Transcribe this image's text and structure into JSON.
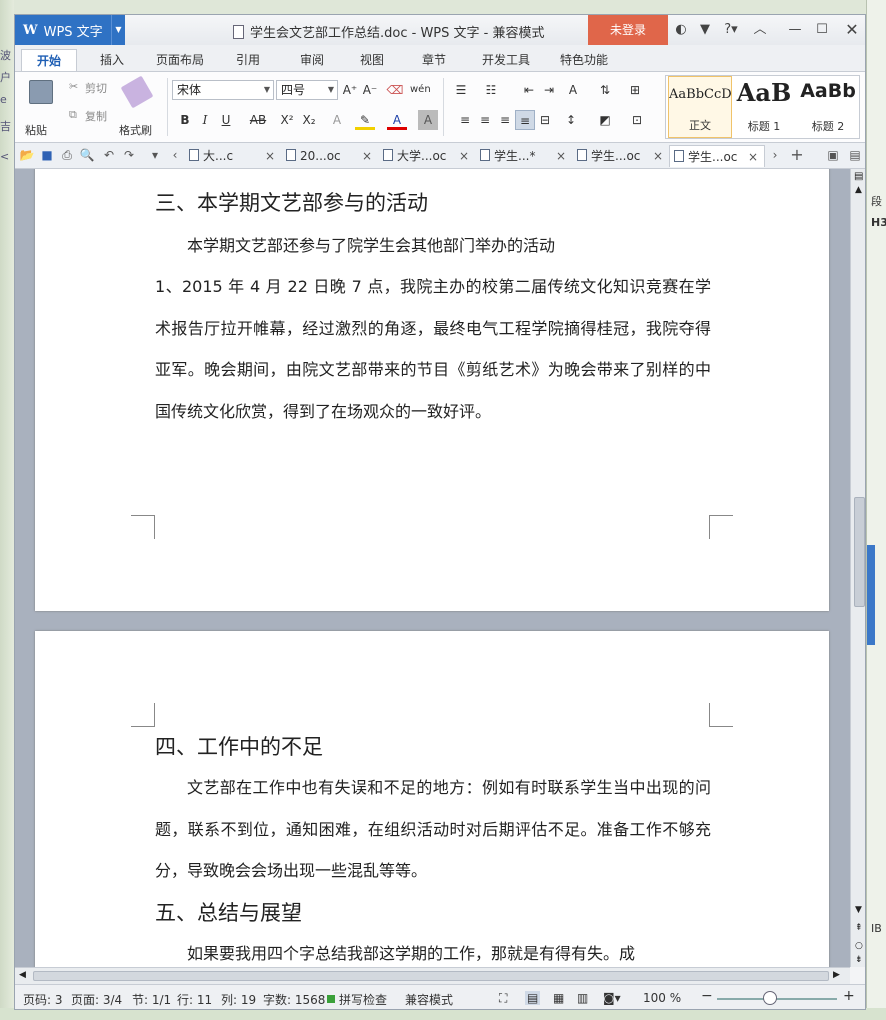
{
  "app": {
    "name": "WPS 文字",
    "login": "未登录"
  },
  "window": {
    "title": "学生会文艺部工作总结.doc - WPS 文字 - 兼容模式"
  },
  "menu_tabs": [
    "开始",
    "插入",
    "页面布局",
    "引用",
    "审阅",
    "视图",
    "章节",
    "开发工具",
    "特色功能"
  ],
  "ribbon": {
    "paste": "粘贴",
    "cut": "剪切",
    "copy": "复制",
    "format_painter": "格式刷",
    "font_name": "宋体",
    "font_size": "四号",
    "styles": [
      {
        "preview": "AaBbCcD",
        "label": "正文"
      },
      {
        "preview": "AaB",
        "label": "标题 1"
      },
      {
        "preview": "AaBb",
        "label": "标题 2"
      }
    ]
  },
  "doc_tabs": [
    {
      "label": "大...c",
      "close": "×"
    },
    {
      "label": "20...oc",
      "close": "×"
    },
    {
      "label": "大学...oc",
      "close": "×"
    },
    {
      "label": "学生...*",
      "close": "×"
    },
    {
      "label": "学生...oc",
      "close": "×"
    },
    {
      "label": "学生...oc",
      "close": "×"
    }
  ],
  "document": {
    "page1": {
      "heading": "三、本学期文艺部参与的活动",
      "para1": "本学期文艺部还参与了院学生会其他部门举办的活动",
      "para2": "1、2015 年 4 月 22 日晚 7 点，我院主办的校第二届传统文化知识竞赛在学术报告厅拉开帷幕，经过激烈的角逐，最终电气工程学院摘得桂冠，我院夺得亚军。晚会期间，由院文艺部带来的节目《剪纸艺术》为晚会带来了别样的中国传统文化欣赏，得到了在场观众的一致好评。"
    },
    "page2": {
      "heading1": "四、工作中的不足",
      "para1": "文艺部在工作中也有失误和不足的地方：例如有时联系学生当中出现的问题，联系不到位，通知困难，在组织活动时对后期评估不足。准备工作不够充分，导致晚会会场出现一些混乱等等。",
      "heading2": "五、总结与展望",
      "para2": "如果要我用四个字总结我部这学期的工作，那就是有得有失。成"
    }
  },
  "status": {
    "page_code": "页码: 3",
    "page": "页面: 3/4",
    "section": "节: 1/1",
    "row": "行: 11",
    "col": "列: 19",
    "word_count": "字数: 1568",
    "spell_check": "拼写检查",
    "compat_mode": "兼容模式",
    "zoom": "100 %"
  },
  "background_fragments": {
    "left": [
      "波",
      "户",
      "e",
      "吉",
      "<"
    ],
    "right": [
      "段",
      "H3",
      "IB"
    ]
  },
  "colors": {
    "app_blue": "#2f72c4",
    "login_red": "#e0664a",
    "page": "#ffffff",
    "canvas": "#a9b1be"
  }
}
